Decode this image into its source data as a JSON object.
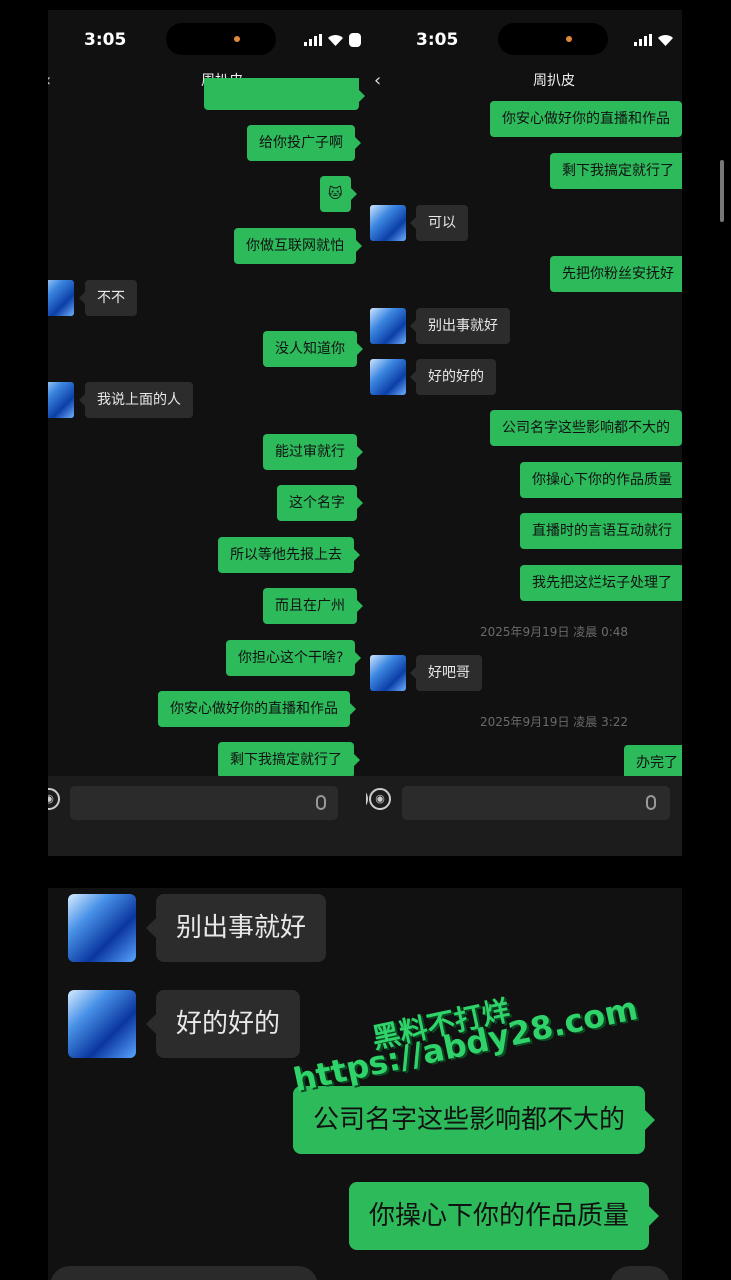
{
  "status": {
    "time": "3:05"
  },
  "chat": {
    "title": "周扒皮",
    "back_icon": "‹"
  },
  "left_messages": [
    {
      "text": "给你投广子啊"
    },
    {
      "text": "🐱"
    },
    {
      "text": "你做互联网就怕"
    },
    {
      "text": "不不"
    },
    {
      "text": "没人知道你"
    },
    {
      "text": "我说上面的人"
    },
    {
      "text": "能过审就行"
    },
    {
      "text": "这个名字"
    },
    {
      "text": "所以等他先报上去"
    },
    {
      "text": "而且在广州"
    },
    {
      "text": "你担心这个干啥?"
    },
    {
      "text": "你安心做好你的直播和作品"
    },
    {
      "text": "剩下我搞定就行了"
    }
  ],
  "right_messages": [
    {
      "text": "你安心做好你的直播和作品"
    },
    {
      "text": "剩下我搞定就行了"
    },
    {
      "text": "可以"
    },
    {
      "text": "先把你粉丝安抚好"
    },
    {
      "text": "别出事就好"
    },
    {
      "text": "好的好的"
    },
    {
      "text": "公司名字这些影响都不大的"
    },
    {
      "text": "你操心下你的作品质量"
    },
    {
      "text": "直播时的言语互动就行"
    },
    {
      "text": "我先把这烂坛子处理了"
    },
    {
      "text": "好吧哥"
    },
    {
      "text": "办完了"
    }
  ],
  "timestamps": [
    "2025年9月19日 凌晨 0:48",
    "2025年9月19日 凌晨 3:22"
  ],
  "zoom_messages": [
    {
      "text": "别出事就好"
    },
    {
      "text": "好的好的"
    },
    {
      "text": "公司名字这些影响都不大的"
    },
    {
      "text": "你操心下你的作品质量"
    }
  ],
  "watermark": {
    "line1": "黑料不打烊",
    "line2": "https://abdy28.com"
  },
  "icons": {
    "voice": "voice-icon",
    "emoji": "emoji-icon",
    "mic": "mic-icon",
    "back": "chevron-left-icon"
  },
  "colors": {
    "outgoing": "#2dba5b",
    "incoming": "#2c2c2c",
    "background": "#111111"
  }
}
